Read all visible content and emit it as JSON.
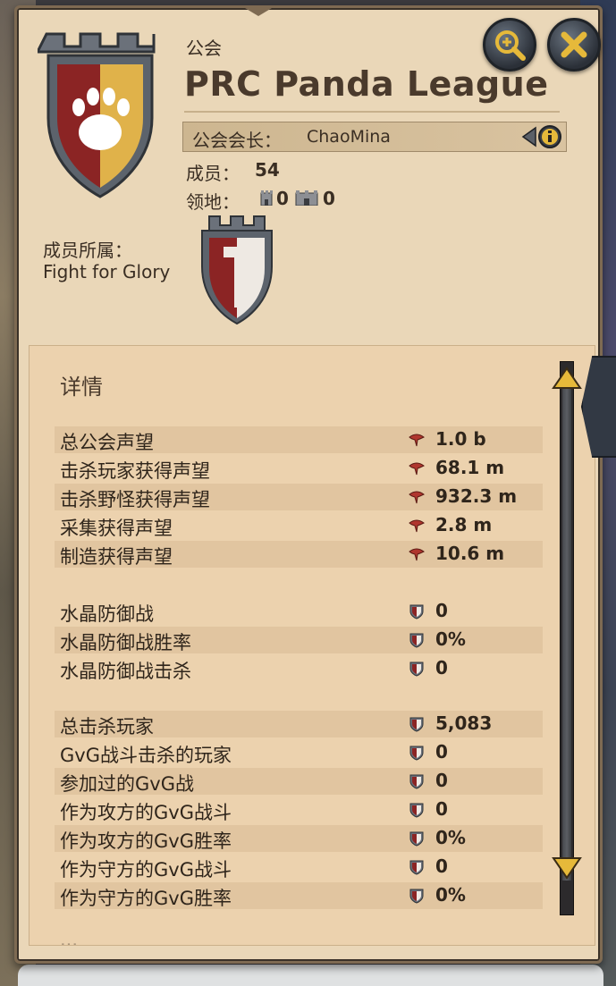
{
  "header": {
    "section_label": "公会",
    "guild_name": "PRC Panda League",
    "leader_label": "公会会长：",
    "leader_name": "ChaoMina",
    "members_label": "成员：",
    "members_count": "54",
    "territory_label": "领地：",
    "territory_castles": "0",
    "territory_outposts": "0",
    "alliance_label": "成员所属：",
    "alliance_name": "Fight for Glory"
  },
  "icons": {
    "zoom": "zoom-in-icon",
    "close": "close-icon",
    "info": "info-icon",
    "fame": "fame-icon",
    "shield": "shield-stat-icon"
  },
  "colors": {
    "panel_bg": "#ead7b8",
    "guild_red": "#8b2424",
    "guild_gold": "#e0b24a",
    "accent_gold": "#e6b93a"
  },
  "details": {
    "title": "详情",
    "rows": [
      {
        "label": "总公会声望",
        "value": "1.0 b",
        "icon": "fame"
      },
      {
        "label": "击杀玩家获得声望",
        "value": "68.1 m",
        "icon": "fame"
      },
      {
        "label": "击杀野怪获得声望",
        "value": "932.3 m",
        "icon": "fame"
      },
      {
        "label": "采集获得声望",
        "value": "2.8 m",
        "icon": "fame"
      },
      {
        "label": "制造获得声望",
        "value": "10.6 m",
        "icon": "fame"
      },
      {
        "label": "水晶防御战",
        "value": "0",
        "icon": "shield"
      },
      {
        "label": "水晶防御战胜率",
        "value": "0%",
        "icon": "shield"
      },
      {
        "label": "水晶防御战击杀",
        "value": "0",
        "icon": "shield"
      },
      {
        "label": "总击杀玩家",
        "value": "5,083",
        "icon": "shield"
      },
      {
        "label": "GvG战斗击杀的玩家",
        "value": "0",
        "icon": "shield"
      },
      {
        "label": "参加过的GvG战",
        "value": "0",
        "icon": "shield"
      },
      {
        "label": "作为攻方的GvG战斗",
        "value": "0",
        "icon": "shield"
      },
      {
        "label": "作为攻方的GvG胜率",
        "value": "0%",
        "icon": "shield"
      },
      {
        "label": "作为守方的GvG战斗",
        "value": "0",
        "icon": "shield"
      },
      {
        "label": "作为守方的GvG胜率",
        "value": "0%",
        "icon": "shield"
      }
    ]
  }
}
